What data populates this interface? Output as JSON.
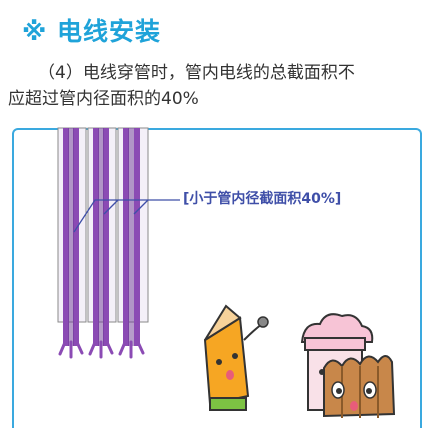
{
  "title": "※ 电线安装",
  "body": {
    "line1": "（4）电线穿管时，管内电线的总截面积不",
    "line2": "应超过管内径面积的40%"
  },
  "callout": "[小于管内径截面积40%]",
  "colors": {
    "title": "#1fa3d9",
    "frame": "#3aa9df",
    "pipe": "#8b4bb4",
    "callout": "#3f4fa8"
  }
}
